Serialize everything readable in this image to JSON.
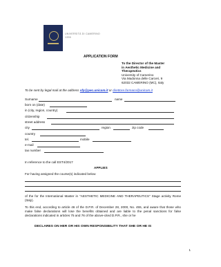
{
  "logo": {
    "line1": "UNIVERSITÀ DI CAMERINO",
    "line2": "1336"
  },
  "form_title": "APPLICATION FORM",
  "recipient": {
    "lines": [
      "To the Director of the Master",
      "in Aesthetic Medicine and",
      "Therapeutics",
      "University of Camerino",
      "Via Madonna delle Carceri, 9",
      "62032 CAMERINO (MC), Italy"
    ]
  },
  "send_note": {
    "prefix": "To be sent by legal mail at the address",
    "email1": "sfp@pec.unicam.it",
    "or": "or",
    "email2": "direttore.farmaco@unicam.it"
  },
  "fields": {
    "surname": "Surname",
    "name": "name",
    "born_on": "born on (date)",
    "in_city": "in (city, region, country)",
    "citizenship": "citizenship",
    "street": "street address",
    "city": "city",
    "region": "region",
    "zip": "zip code",
    "country": "country",
    "tel": "tel.",
    "mobile": "mobile",
    "email": "e-mail",
    "tax": "tax number"
  },
  "call_ref": "In reference to the call EST4/2017",
  "applies": "APPLIES",
  "courses_intro": "For having assigned the course(s) indicated below",
  "master_text": "of the for the International Master in \"AESTHETIC MEDICINE AND THERAPEUTICS\" Stage activity Rome (Italy).",
  "decl_text": "To this end, according to article 46 of the D.P.R. of December 28, 2000, No. 455, and aware that those who make false declarations will lose the benefits obtained and are liable to the penal sanctions for false declarations indicated in articles 75 and 76 of the above-cited D.P.R., she or he",
  "declares": "DECLARES ON HER OR HIS OWN RESPONSIBILITY THAT SHE OR HE IS",
  "page_number": "1"
}
